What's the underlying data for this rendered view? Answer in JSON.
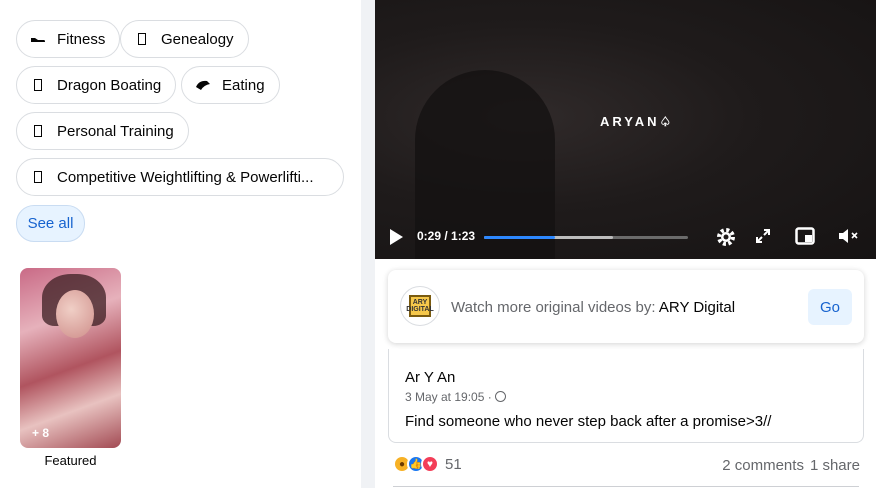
{
  "interests": [
    {
      "label": "Fitness",
      "icon": "sneaker-icon"
    },
    {
      "label": "Genealogy",
      "icon": "missing-glyph-icon"
    },
    {
      "label": "Dragon Boating",
      "icon": "missing-glyph-icon"
    },
    {
      "label": "Eating",
      "icon": "burrito-icon"
    },
    {
      "label": "Personal Training",
      "icon": "missing-glyph-icon"
    },
    {
      "label": "Competitive Weightlifting & Powerlifti...",
      "icon": "missing-glyph-icon"
    }
  ],
  "see_all_label": "See all",
  "story": {
    "count": "+ 8",
    "caption": "Featured"
  },
  "video": {
    "watermark": "ARYAN♤",
    "time": "0:29 / 1:23",
    "progress": 0.35,
    "buffered": 0.63
  },
  "promo": {
    "prefix": "Watch more original videos by: ",
    "channel": "ARY Digital",
    "go_label": "Go",
    "logo_text": "ARY DIGITAL"
  },
  "post": {
    "author": "Ar Y An",
    "timestamp": "3 May at 19:05 ·",
    "text": "Find someone who never step back after a promise>3//"
  },
  "footer": {
    "reaction_count": "51",
    "comments": "2 comments",
    "shares": "1 share"
  },
  "colors": {
    "accent": "#1763cf",
    "progress": "#2d88ff",
    "chip_border": "#dadde1"
  }
}
